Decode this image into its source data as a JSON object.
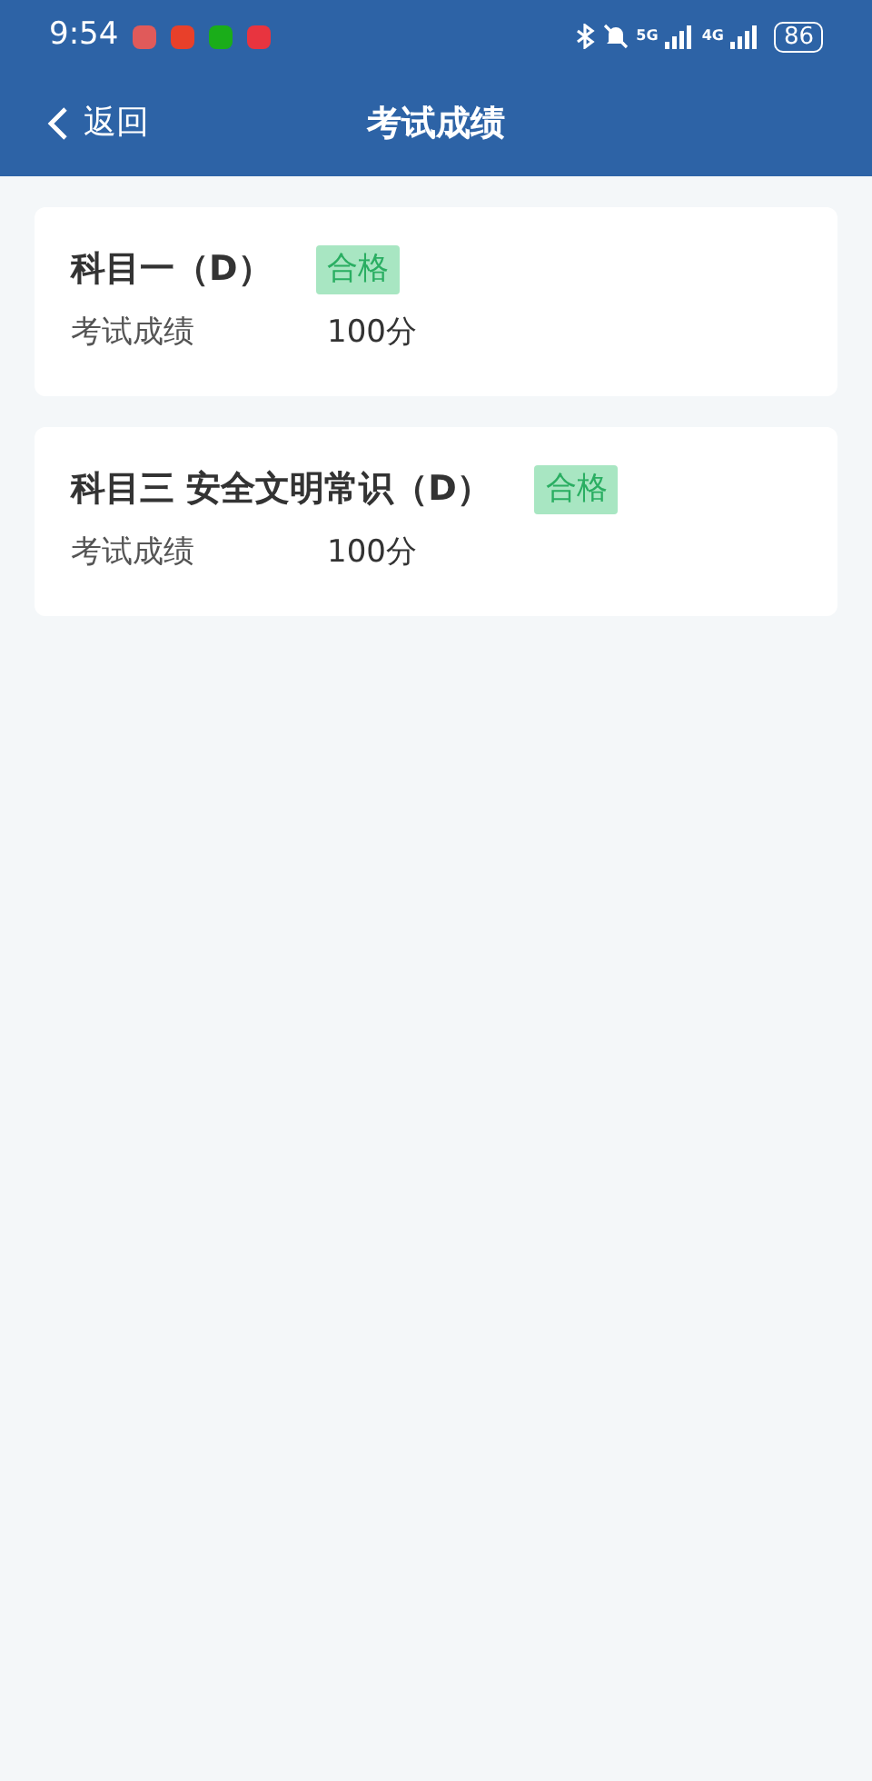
{
  "status_bar": {
    "time": "9:54",
    "network_5g": "5G",
    "network_4g": "4G",
    "battery": "86"
  },
  "header": {
    "back": "返回",
    "title": "考试成绩"
  },
  "results": [
    {
      "subject": "科目一（D）",
      "tag": "合格",
      "label": "考试成绩",
      "score": "100分"
    },
    {
      "subject": "科目三 安全文明常识（D）",
      "tag": "合格",
      "label": "考试成绩",
      "score": "100分"
    }
  ]
}
